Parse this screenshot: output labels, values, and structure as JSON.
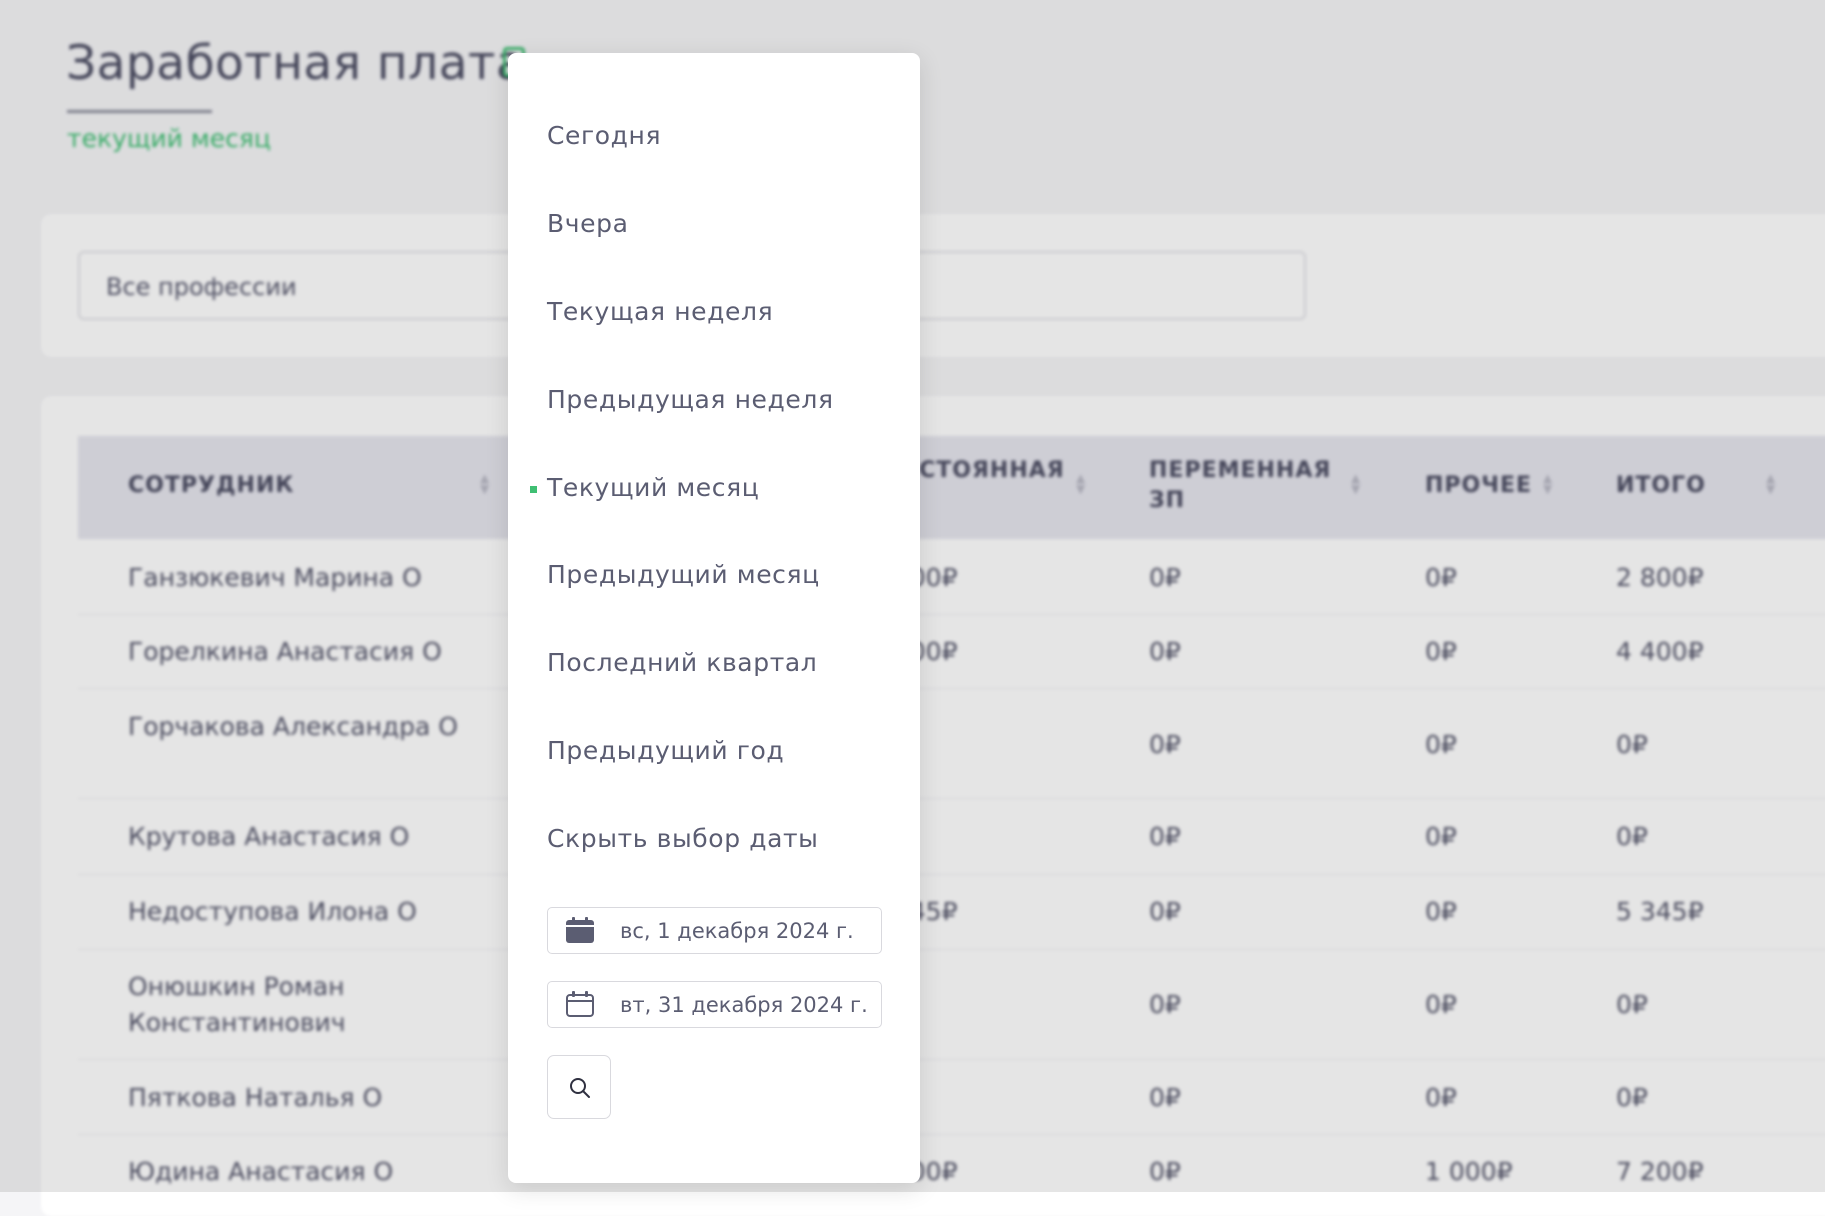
{
  "page": {
    "title": "Заработная плата",
    "period_link": "текущий месяц"
  },
  "filters": {
    "profession_select": "Все профессии"
  },
  "table": {
    "headers": {
      "employee": "СОТРУДНИК",
      "fixed_line1": "ПОСТОЯННАЯ",
      "variable_line1": "ПЕРЕМЕННАЯ",
      "variable_line2": "ЗП",
      "other": "ПРОЧЕЕ",
      "total": "ИТОГО"
    },
    "rows": [
      {
        "name": "Ганзюкевич Марина О",
        "fixed": "2 800₽",
        "variable": "0₽",
        "other": "0₽",
        "total": "2 800₽"
      },
      {
        "name": "Горелкина Анастасия О",
        "fixed": "4 400₽",
        "variable": "0₽",
        "other": "0₽",
        "total": "4 400₽"
      },
      {
        "name": "Горчакова Александра О",
        "fixed": "",
        "variable": "0₽",
        "other": "0₽",
        "total": "0₽"
      },
      {
        "name": "Крутова Анастасия О",
        "fixed": "",
        "variable": "0₽",
        "other": "0₽",
        "total": "0₽"
      },
      {
        "name": "Недоступова Илона О",
        "fixed": "5 345₽",
        "variable": "0₽",
        "other": "0₽",
        "total": "5 345₽"
      },
      {
        "name": "Онюшкин Роман Константинович",
        "fixed": "",
        "variable": "0₽",
        "other": "0₽",
        "total": "0₽"
      },
      {
        "name": "Пяткова Наталья О",
        "fixed": "",
        "variable": "0₽",
        "other": "0₽",
        "total": "0₽"
      },
      {
        "name": "Юдина Анастасия О",
        "fixed": "6 200₽",
        "variable": "0₽",
        "other": "1 000₽",
        "total": "7 200₽"
      }
    ]
  },
  "date_dropdown": {
    "items": [
      "Сегодня",
      "Вчера",
      "Текущая неделя",
      "Предыдущая неделя",
      "Текущий месяц",
      "Предыдущий месяц",
      "Последний квартал",
      "Предыдущий год",
      "Скрыть выбор даты"
    ],
    "active_item": "Текущий месяц",
    "date_from": "вс, 1 декабря 2024 г.",
    "date_to": "вт, 31 декабря 2024 г."
  },
  "colors": {
    "accent": "#3fbf73",
    "text": "#5b5d72",
    "header_bg": "#e6e6ee"
  },
  "icons": {
    "title": "calendar-icon",
    "date_from": "calendar-filled-icon",
    "date_to": "calendar-outline-icon",
    "search": "search-icon",
    "sort": "sort-icon"
  }
}
